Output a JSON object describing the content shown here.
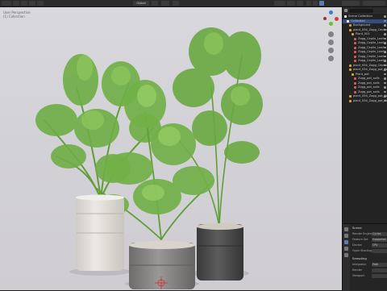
{
  "header": {
    "menu_items": [
      "Edit",
      "Render",
      "Window",
      "Help"
    ],
    "mode_label": "Object",
    "view_label": "Global"
  },
  "viewport": {
    "overlay_text": [
      "User Perspective",
      "(1) Collection"
    ]
  },
  "outliner": {
    "search_placeholder": "",
    "rows": [
      {
        "label": "Scene Collection",
        "depth": 0,
        "icon": "collection-icon",
        "color": "#ffffff"
      },
      {
        "label": "Collection",
        "depth": 1,
        "icon": "collection-icon",
        "color": "#ffffff",
        "selected": true
      },
      {
        "label": "Background",
        "depth": 2,
        "icon": "object-icon",
        "color": "#e59a3c"
      },
      {
        "label": "plant_054_Zogg_Ceplin",
        "depth": 2,
        "icon": "object-icon",
        "color": "#e59a3c"
      },
      {
        "label": "Plant_001",
        "depth": 3,
        "icon": "object-icon",
        "color": "#e59a3c"
      },
      {
        "label": "Zogg_Ceplin_Leaf",
        "depth": 4,
        "icon": "material-icon",
        "color": "#d65b5b"
      },
      {
        "label": "Zogg_Ceplin_Leaf",
        "depth": 4,
        "icon": "material-icon",
        "color": "#d65b5b"
      },
      {
        "label": "Zogg_Ceplin_Leaf",
        "depth": 4,
        "icon": "material-icon",
        "color": "#d65b5b"
      },
      {
        "label": "Zogg_Ceplin_Leaf",
        "depth": 4,
        "icon": "material-icon",
        "color": "#d65b5b"
      },
      {
        "label": "Zogg_Ceplin_Leaf",
        "depth": 4,
        "icon": "material-icon",
        "color": "#d65b5b"
      },
      {
        "label": "Zogg_Ceplin_Leaf",
        "depth": 4,
        "icon": "material-icon",
        "color": "#d65b5b"
      },
      {
        "label": "plant_054_Zogg_Ceplin",
        "depth": 2,
        "icon": "object-icon",
        "color": "#e59a3c"
      },
      {
        "label": "plant_054_Zogg_pot_Ceplin",
        "depth": 2,
        "icon": "object-icon",
        "color": "#e59a3c"
      },
      {
        "label": "Plant_pot",
        "depth": 3,
        "icon": "object-icon",
        "color": "#e59a3c"
      },
      {
        "label": "Zogg_pot_soils",
        "depth": 4,
        "icon": "material-icon",
        "color": "#d65b5b"
      },
      {
        "label": "Zogg_pot_soils",
        "depth": 4,
        "icon": "material-icon",
        "color": "#d65b5b"
      },
      {
        "label": "Zogg_pot_soils",
        "depth": 4,
        "icon": "material-icon",
        "color": "#d65b5b"
      },
      {
        "label": "Zogg_pot_soils",
        "depth": 4,
        "icon": "material-icon",
        "color": "#d65b5b"
      },
      {
        "label": "plant_054_Zogg_pot_Ceplin",
        "depth": 2,
        "icon": "object-icon",
        "color": "#e59a3c"
      },
      {
        "label": "plant_054_Zogg_pot_Ceplin",
        "depth": 2,
        "icon": "object-icon",
        "color": "#e59a3c"
      }
    ]
  },
  "properties": {
    "section_title": "Scene",
    "rows": [
      {
        "label": "Render Engine",
        "value": "Cycles"
      },
      {
        "label": "Feature Set",
        "value": "Supported"
      },
      {
        "label": "Device",
        "value": "CPU"
      },
      {
        "label": "Open Shading Language",
        "value": ""
      }
    ],
    "sampling_title": "Sampling",
    "sampling_rows": [
      {
        "label": "Integrator",
        "value": "Path Tracing"
      },
      {
        "label": "Render",
        "value": ""
      },
      {
        "label": "Viewport",
        "value": ""
      }
    ]
  },
  "colors": {
    "viewport_bg": "#d5d4d9",
    "panel_bg": "#232323",
    "selection": "#334d80",
    "accent_orange": "#e59a3c",
    "leaf_green": "#6aa842",
    "pot_white": "#e6e3de",
    "pot_gray": "#8a8886",
    "pot_dark": "#4a4a4a"
  }
}
